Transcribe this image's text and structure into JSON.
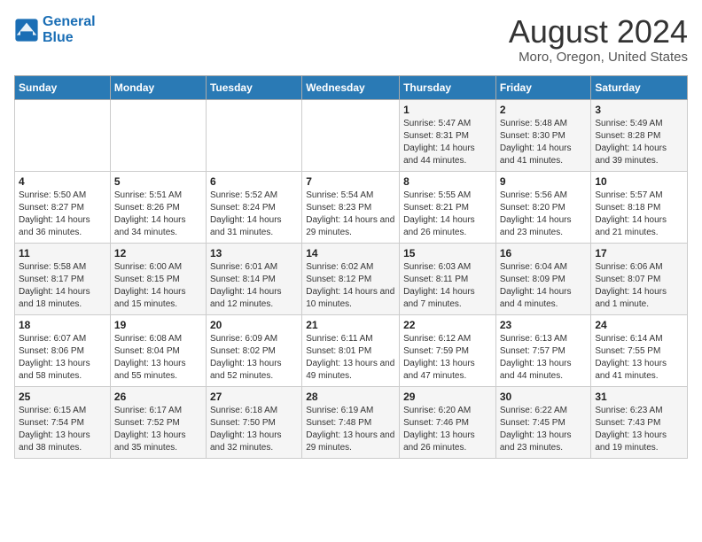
{
  "logo": {
    "line1": "General",
    "line2": "Blue"
  },
  "header": {
    "title": "August 2024",
    "subtitle": "Moro, Oregon, United States"
  },
  "days_of_week": [
    "Sunday",
    "Monday",
    "Tuesday",
    "Wednesday",
    "Thursday",
    "Friday",
    "Saturday"
  ],
  "weeks": [
    [
      {
        "day": "",
        "info": ""
      },
      {
        "day": "",
        "info": ""
      },
      {
        "day": "",
        "info": ""
      },
      {
        "day": "",
        "info": ""
      },
      {
        "day": "1",
        "info": "Sunrise: 5:47 AM\nSunset: 8:31 PM\nDaylight: 14 hours and 44 minutes."
      },
      {
        "day": "2",
        "info": "Sunrise: 5:48 AM\nSunset: 8:30 PM\nDaylight: 14 hours and 41 minutes."
      },
      {
        "day": "3",
        "info": "Sunrise: 5:49 AM\nSunset: 8:28 PM\nDaylight: 14 hours and 39 minutes."
      }
    ],
    [
      {
        "day": "4",
        "info": "Sunrise: 5:50 AM\nSunset: 8:27 PM\nDaylight: 14 hours and 36 minutes."
      },
      {
        "day": "5",
        "info": "Sunrise: 5:51 AM\nSunset: 8:26 PM\nDaylight: 14 hours and 34 minutes."
      },
      {
        "day": "6",
        "info": "Sunrise: 5:52 AM\nSunset: 8:24 PM\nDaylight: 14 hours and 31 minutes."
      },
      {
        "day": "7",
        "info": "Sunrise: 5:54 AM\nSunset: 8:23 PM\nDaylight: 14 hours and 29 minutes."
      },
      {
        "day": "8",
        "info": "Sunrise: 5:55 AM\nSunset: 8:21 PM\nDaylight: 14 hours and 26 minutes."
      },
      {
        "day": "9",
        "info": "Sunrise: 5:56 AM\nSunset: 8:20 PM\nDaylight: 14 hours and 23 minutes."
      },
      {
        "day": "10",
        "info": "Sunrise: 5:57 AM\nSunset: 8:18 PM\nDaylight: 14 hours and 21 minutes."
      }
    ],
    [
      {
        "day": "11",
        "info": "Sunrise: 5:58 AM\nSunset: 8:17 PM\nDaylight: 14 hours and 18 minutes."
      },
      {
        "day": "12",
        "info": "Sunrise: 6:00 AM\nSunset: 8:15 PM\nDaylight: 14 hours and 15 minutes."
      },
      {
        "day": "13",
        "info": "Sunrise: 6:01 AM\nSunset: 8:14 PM\nDaylight: 14 hours and 12 minutes."
      },
      {
        "day": "14",
        "info": "Sunrise: 6:02 AM\nSunset: 8:12 PM\nDaylight: 14 hours and 10 minutes."
      },
      {
        "day": "15",
        "info": "Sunrise: 6:03 AM\nSunset: 8:11 PM\nDaylight: 14 hours and 7 minutes."
      },
      {
        "day": "16",
        "info": "Sunrise: 6:04 AM\nSunset: 8:09 PM\nDaylight: 14 hours and 4 minutes."
      },
      {
        "day": "17",
        "info": "Sunrise: 6:06 AM\nSunset: 8:07 PM\nDaylight: 14 hours and 1 minute."
      }
    ],
    [
      {
        "day": "18",
        "info": "Sunrise: 6:07 AM\nSunset: 8:06 PM\nDaylight: 13 hours and 58 minutes."
      },
      {
        "day": "19",
        "info": "Sunrise: 6:08 AM\nSunset: 8:04 PM\nDaylight: 13 hours and 55 minutes."
      },
      {
        "day": "20",
        "info": "Sunrise: 6:09 AM\nSunset: 8:02 PM\nDaylight: 13 hours and 52 minutes."
      },
      {
        "day": "21",
        "info": "Sunrise: 6:11 AM\nSunset: 8:01 PM\nDaylight: 13 hours and 49 minutes."
      },
      {
        "day": "22",
        "info": "Sunrise: 6:12 AM\nSunset: 7:59 PM\nDaylight: 13 hours and 47 minutes."
      },
      {
        "day": "23",
        "info": "Sunrise: 6:13 AM\nSunset: 7:57 PM\nDaylight: 13 hours and 44 minutes."
      },
      {
        "day": "24",
        "info": "Sunrise: 6:14 AM\nSunset: 7:55 PM\nDaylight: 13 hours and 41 minutes."
      }
    ],
    [
      {
        "day": "25",
        "info": "Sunrise: 6:15 AM\nSunset: 7:54 PM\nDaylight: 13 hours and 38 minutes."
      },
      {
        "day": "26",
        "info": "Sunrise: 6:17 AM\nSunset: 7:52 PM\nDaylight: 13 hours and 35 minutes."
      },
      {
        "day": "27",
        "info": "Sunrise: 6:18 AM\nSunset: 7:50 PM\nDaylight: 13 hours and 32 minutes."
      },
      {
        "day": "28",
        "info": "Sunrise: 6:19 AM\nSunset: 7:48 PM\nDaylight: 13 hours and 29 minutes."
      },
      {
        "day": "29",
        "info": "Sunrise: 6:20 AM\nSunset: 7:46 PM\nDaylight: 13 hours and 26 minutes."
      },
      {
        "day": "30",
        "info": "Sunrise: 6:22 AM\nSunset: 7:45 PM\nDaylight: 13 hours and 23 minutes."
      },
      {
        "day": "31",
        "info": "Sunrise: 6:23 AM\nSunset: 7:43 PM\nDaylight: 13 hours and 19 minutes."
      }
    ]
  ]
}
